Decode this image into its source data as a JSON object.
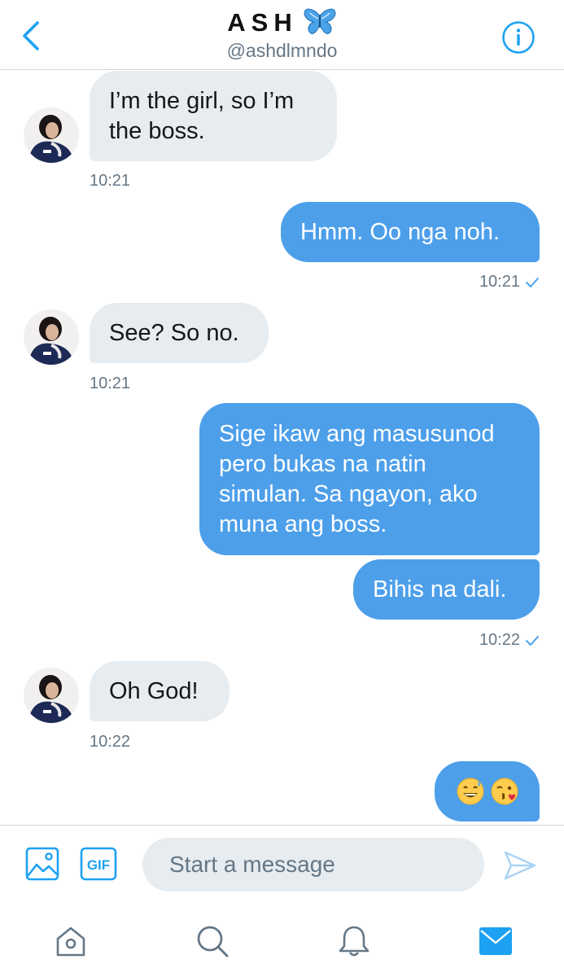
{
  "header": {
    "title": "ASH",
    "title_emoji_icon": "blue-butterfly-icon",
    "handle": "@ashdlmndo"
  },
  "messages": [
    {
      "direction": "incoming",
      "lines": [
        "I’m the girl, so I’m",
        "the boss."
      ],
      "time": "10:21"
    },
    {
      "direction": "outgoing",
      "lines": [
        "Hmm. Oo nga noh."
      ],
      "time": "10:21"
    },
    {
      "direction": "incoming",
      "lines": [
        "See? So no."
      ],
      "time": "10:21"
    },
    {
      "direction": "outgoing",
      "lines": [
        "Sige ikaw ang masusunod",
        "pero bukas na natin",
        "simulan. Sa ngayon, ako",
        "muna ang boss."
      ]
    },
    {
      "direction": "outgoing",
      "lines": [
        "Bihis na dali."
      ],
      "time": "10:22"
    },
    {
      "direction": "incoming",
      "lines": [
        "Oh God!"
      ],
      "time": "10:22"
    },
    {
      "direction": "outgoing",
      "emoji": [
        "grinning-sweat-emoji",
        "face-blowing-kiss-emoji"
      ]
    }
  ],
  "composer": {
    "placeholder": "Start a message",
    "gif_label": "GIF"
  },
  "colors": {
    "accent": "#4d9fea",
    "incoming_bubble": "#e6ecf0",
    "secondary_text": "#657786",
    "icon_blue": "#1da1f2"
  },
  "tabs": [
    "home-icon",
    "search-icon",
    "notifications-icon",
    "messages-icon"
  ],
  "active_tab": "messages-icon"
}
